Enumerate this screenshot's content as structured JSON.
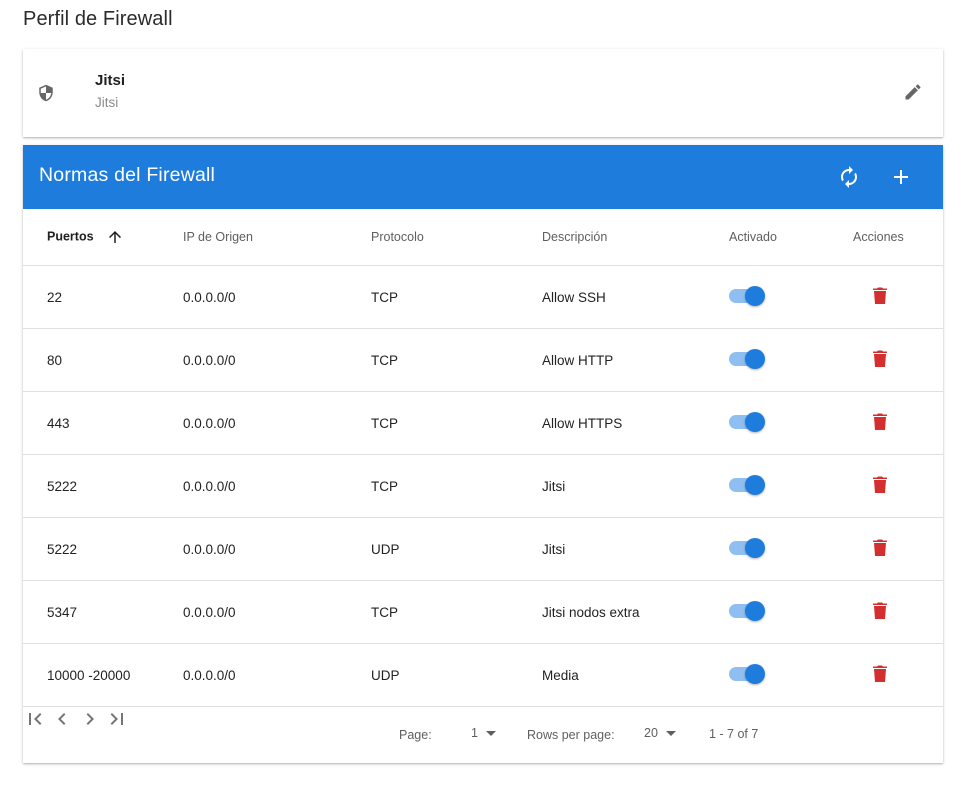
{
  "page": {
    "title": "Perfil de Firewall"
  },
  "profile": {
    "name": "Jitsi",
    "subtitle": "Jitsi",
    "icon": "shield-icon",
    "edit_icon": "pencil-icon"
  },
  "rules": {
    "title": "Normas del Firewall",
    "toolbar_icons": [
      "refresh-icon",
      "plus-icon"
    ],
    "accent_color": "#1e7ddc",
    "columns": [
      "Puertos",
      "IP de Origen",
      "Protocolo",
      "Descripción",
      "Activado",
      "Acciones"
    ],
    "sort": {
      "column": "Puertos",
      "direction": "asc"
    },
    "rows": [
      {
        "ports": "22",
        "source_ip": "0.0.0.0/0",
        "protocol": "TCP",
        "description": "Allow SSH",
        "enabled": true
      },
      {
        "ports": "80",
        "source_ip": "0.0.0.0/0",
        "protocol": "TCP",
        "description": "Allow HTTP",
        "enabled": true
      },
      {
        "ports": "443",
        "source_ip": "0.0.0.0/0",
        "protocol": "TCP",
        "description": "Allow HTTPS",
        "enabled": true
      },
      {
        "ports": "5222",
        "source_ip": "0.0.0.0/0",
        "protocol": "TCP",
        "description": "Jitsi",
        "enabled": true
      },
      {
        "ports": "5222",
        "source_ip": "0.0.0.0/0",
        "protocol": "UDP",
        "description": "Jitsi",
        "enabled": true
      },
      {
        "ports": "5347",
        "source_ip": "0.0.0.0/0",
        "protocol": "TCP",
        "description": "Jitsi nodos extra",
        "enabled": true
      },
      {
        "ports": "10000 -20000",
        "source_ip": "0.0.0.0/0",
        "protocol": "UDP",
        "description": "Media",
        "enabled": true
      }
    ],
    "delete_color": "#d32f2f"
  },
  "pagination": {
    "page_label": "Page:",
    "page_value": "1",
    "rows_label": "Rows per page:",
    "rows_value": "20",
    "range_text": "1 - 7 of 7"
  }
}
